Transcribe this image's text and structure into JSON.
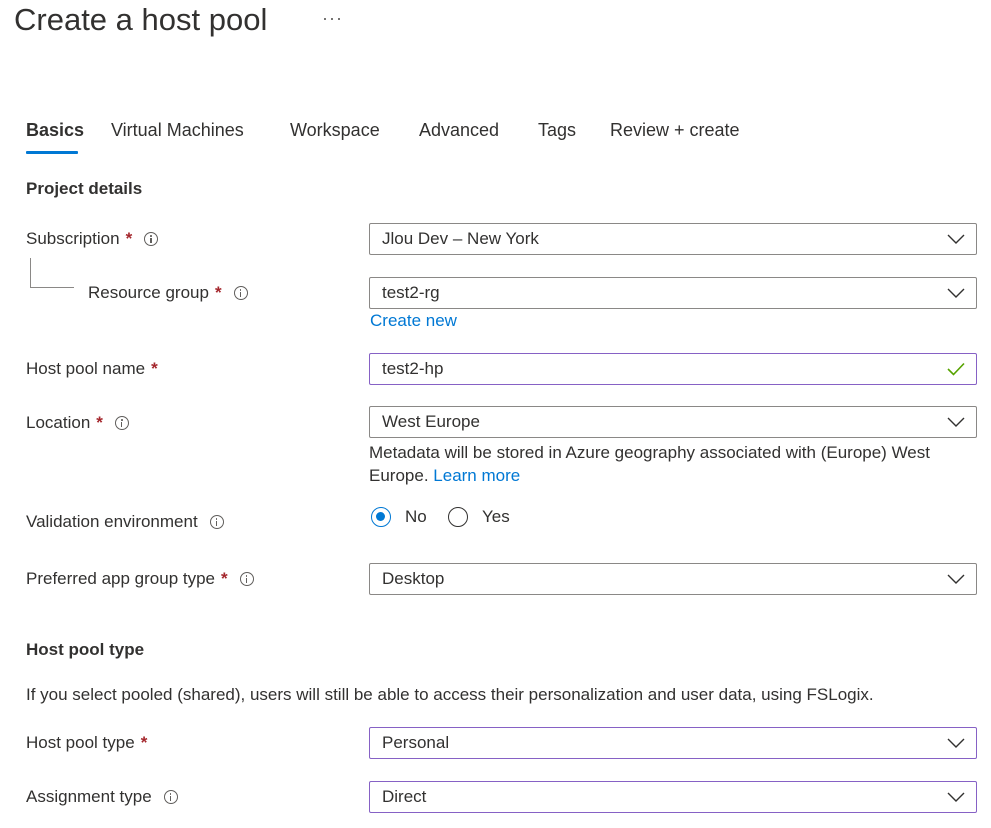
{
  "header": {
    "title": "Create a host pool",
    "more_label": "···"
  },
  "tabs": [
    {
      "label": "Basics",
      "active": true
    },
    {
      "label": "Virtual Machines",
      "active": false
    },
    {
      "label": "Workspace",
      "active": false
    },
    {
      "label": "Advanced",
      "active": false
    },
    {
      "label": "Tags",
      "active": false
    },
    {
      "label": "Review + create",
      "active": false
    }
  ],
  "project_details": {
    "heading": "Project details",
    "subscription": {
      "label": "Subscription",
      "required": "*",
      "value": "Jlou Dev – New York"
    },
    "resource_group": {
      "label": "Resource group",
      "required": "*",
      "value": "test2-rg",
      "create_new": "Create new"
    },
    "host_pool_name": {
      "label": "Host pool name",
      "required": "*",
      "value": "test2-hp"
    },
    "location": {
      "label": "Location",
      "required": "*",
      "value": "West Europe",
      "helper": "Metadata will be stored in Azure geography associated with (Europe) West Europe.",
      "learn_more": "Learn more"
    },
    "validation_environment": {
      "label": "Validation environment",
      "options": [
        "No",
        "Yes"
      ],
      "selected": "No"
    },
    "preferred_app_group_type": {
      "label": "Preferred app group type",
      "required": "*",
      "value": "Desktop"
    }
  },
  "host_pool_type_section": {
    "heading": "Host pool type",
    "description": "If you select pooled (shared), users will still be able to access their personalization and user data, using FSLogix.",
    "host_pool_type": {
      "label": "Host pool type",
      "required": "*",
      "value": "Personal"
    },
    "assignment_type": {
      "label": "Assignment type",
      "value": "Direct"
    }
  },
  "colors": {
    "accent": "#0078d4",
    "required": "#a4262c",
    "valid_check": "#57a300",
    "focus_border": "#8661c5"
  }
}
